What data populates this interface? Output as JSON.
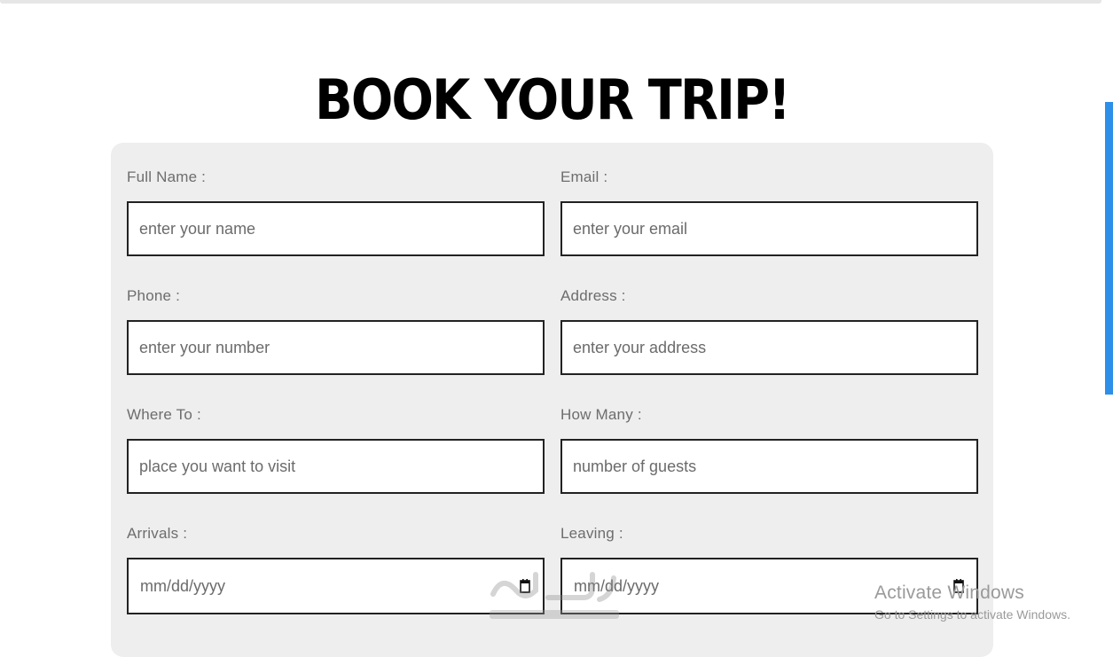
{
  "page": {
    "title": "BOOK YOUR TRIP!"
  },
  "form": {
    "fields": [
      {
        "label": "Full Name :",
        "placeholder": "enter your name"
      },
      {
        "label": "Email :",
        "placeholder": "enter your email"
      },
      {
        "label": "Phone :",
        "placeholder": "enter your number"
      },
      {
        "label": "Address :",
        "placeholder": "enter your address"
      },
      {
        "label": "Where To :",
        "placeholder": "place you want to visit"
      },
      {
        "label": "How Many :",
        "placeholder": "number of guests"
      },
      {
        "label": "Arrivals :",
        "value": "mm/dd/yyyy",
        "icon": "calendar-icon"
      },
      {
        "label": "Leaving :",
        "value": "mm/dd/yyyy",
        "icon": "calendar-icon"
      }
    ]
  },
  "watermark": {
    "title": "Activate Windows",
    "subtitle": "Go to Settings to activate Windows.",
    "logo": "mostaql-logo"
  },
  "colors": {
    "card_bg": "#eeeeee",
    "scrollbar": "#2d8fe8",
    "label": "#6d6d6d",
    "border": "#222222"
  }
}
